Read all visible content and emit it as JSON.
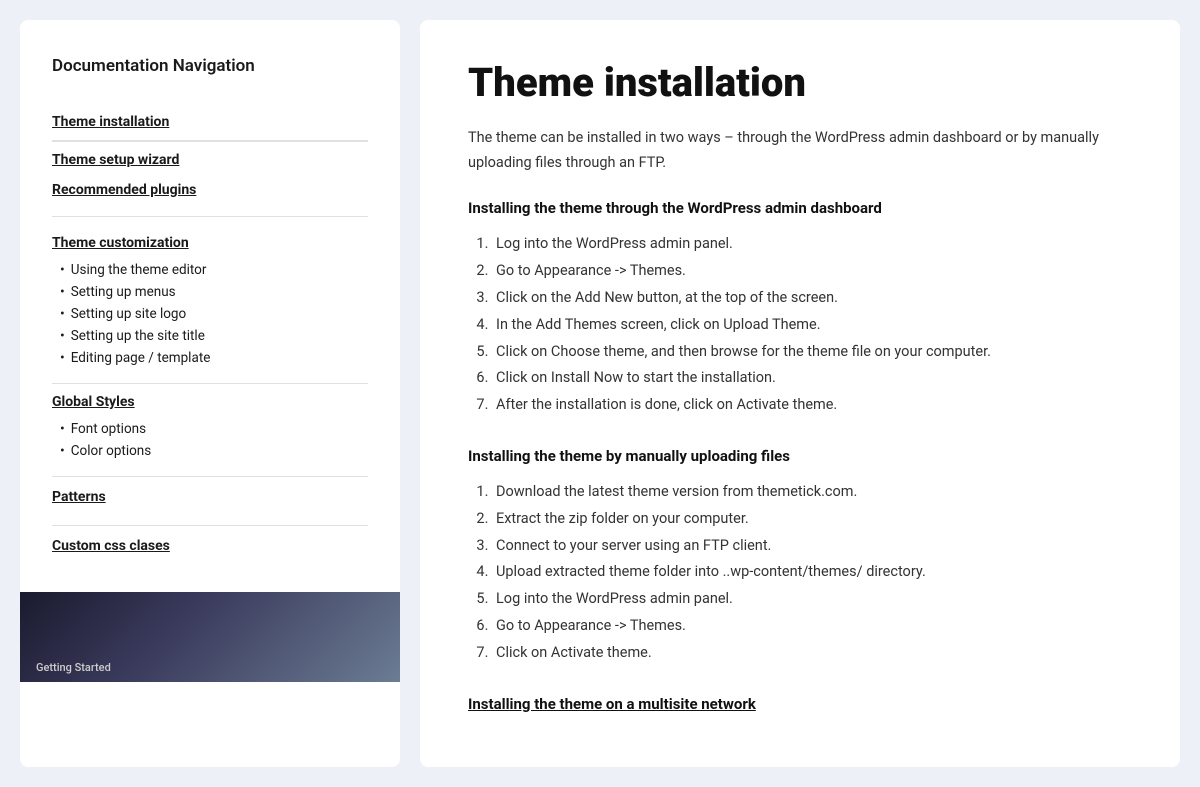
{
  "sidebar": {
    "title": "Documentation Navigation",
    "top_links": [
      {
        "label": "Theme installation",
        "id": "theme-installation"
      },
      {
        "label": "Theme setup wizard",
        "id": "theme-setup-wizard"
      },
      {
        "label": "Recommended plugins",
        "id": "recommended-plugins"
      }
    ],
    "sections": [
      {
        "id": "theme-customization",
        "title": "Theme customization",
        "items": [
          "Using the theme editor",
          "Setting up menus",
          "Setting up site logo",
          "Setting up the site title",
          "Editing page / template"
        ]
      },
      {
        "id": "global-styles",
        "title": "Global Styles",
        "items": [
          "Font options",
          "Color options"
        ]
      }
    ],
    "bottom_links": [
      {
        "label": "Patterns",
        "id": "patterns"
      },
      {
        "label": "Custom css clases",
        "id": "custom-css-classes"
      }
    ]
  },
  "main": {
    "page_title": "Theme installation",
    "intro": "The theme can be installed in two ways – through the WordPress admin dashboard or by manually uploading files through an FTP.",
    "sections": [
      {
        "id": "admin-install",
        "heading": "Installing the theme through the WordPress admin dashboard",
        "type": "ordered",
        "items": [
          "Log into the WordPress admin panel.",
          "Go to Appearance -> Themes.",
          "Click on the Add New button, at the top of the screen.",
          "In the Add Themes screen, click on Upload Theme.",
          "Click on Choose theme, and then browse for the theme file on your computer.",
          "Click on Install Now to start the installation.",
          "After the installation is done, click on Activate theme."
        ]
      },
      {
        "id": "manual-install",
        "heading": "Installing the theme by manually uploading files",
        "type": "ordered",
        "items": [
          "Download the latest theme version from themetick.com.",
          "Extract the zip folder on your computer.",
          "Connect to your server using an FTP client.",
          "Upload extracted theme folder into ..wp-content/themes/ directory.",
          "Log into the WordPress admin panel.",
          "Go to Appearance -> Themes.",
          "Click on Activate theme."
        ]
      },
      {
        "id": "multisite-install",
        "heading": "Installing the theme on a multisite network",
        "type": "underline"
      }
    ]
  }
}
